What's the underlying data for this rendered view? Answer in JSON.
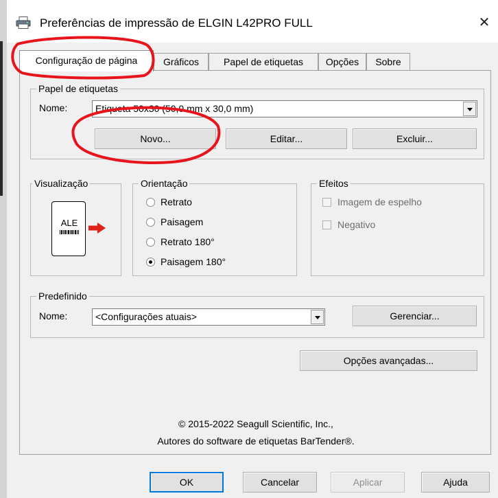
{
  "window": {
    "title": "Preferências de impressão de ELGIN L42PRO FULL",
    "close_glyph": "✕",
    "icon": "printer-icon"
  },
  "tabs": [
    {
      "label": "Configuração de página",
      "active": true
    },
    {
      "label": "Gráficos",
      "active": false
    },
    {
      "label": "Papel de etiquetas",
      "active": false
    },
    {
      "label": "Opções",
      "active": false
    },
    {
      "label": "Sobre",
      "active": false
    }
  ],
  "label_paper": {
    "legend": "Papel de etiquetas",
    "name_label": "Nome:",
    "selected": "Etiqueta 50x30 (50,0 mm x 30,0 mm)",
    "buttons": {
      "new": "Novo...",
      "edit": "Editar...",
      "delete": "Excluir..."
    }
  },
  "preview": {
    "legend": "Visualização",
    "label_text": "ALE",
    "arrow_color": "#e0201b"
  },
  "orientation": {
    "legend": "Orientação",
    "options": [
      {
        "label": "Retrato",
        "selected": false
      },
      {
        "label": "Paisagem",
        "selected": false
      },
      {
        "label": "Retrato 180°",
        "selected": false
      },
      {
        "label": "Paisagem 180°",
        "selected": true
      }
    ]
  },
  "effects": {
    "legend": "Efeitos",
    "options": [
      {
        "label": "Imagem de espelho",
        "checked": false,
        "enabled": false
      },
      {
        "label": "Negativo",
        "checked": false,
        "enabled": false
      }
    ]
  },
  "preset": {
    "legend": "Predefinido",
    "name_label": "Nome:",
    "selected": "<Configurações atuais>",
    "manage_button": "Gerenciar..."
  },
  "advanced_button": "Opções avançadas...",
  "copyright": {
    "line1": "© 2015-2022 Seagull Scientific, Inc.,",
    "line2": "Autores do software de etiquetas BarTender®."
  },
  "footer": {
    "ok": "OK",
    "cancel": "Cancelar",
    "apply": "Aplicar",
    "help": "Ajuda"
  },
  "annotation_color": "#e8141c"
}
